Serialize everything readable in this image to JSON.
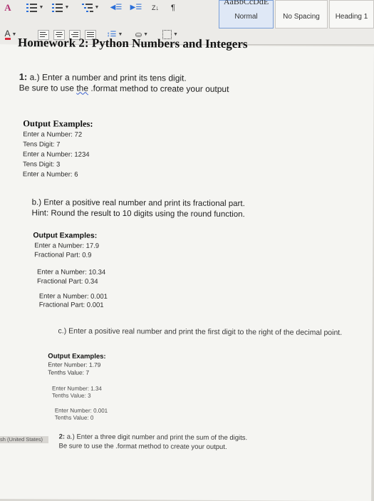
{
  "ribbon": {
    "style_heading_sample": "AaBbCcDdE",
    "styles": [
      "Normal",
      "No Spacing",
      "Heading 1"
    ],
    "sort_label": "Z↓"
  },
  "document": {
    "title": "Homework 2: Python Numbers and Integers",
    "q1": {
      "num": "1:",
      "line1": "a.) Enter a number and print its tens digit.",
      "line2_pre": "Be sure to use ",
      "line2_the": "the",
      "line2_post": " .format method to create your output"
    },
    "q1a_examples": {
      "heading": "Output Examples:",
      "lines": [
        "Enter a Number: 72",
        "Tens Digit: 7",
        "Enter a Number: 1234",
        "Tens Digit: 3",
        "Enter a Number: 6"
      ]
    },
    "q1b": {
      "line1": "b.) Enter a positive real number and print its fractional part.",
      "line2": "Hint: Round the result to 10 digits using the round function."
    },
    "q1b_examples": {
      "heading": "Output Examples:",
      "lines": [
        "Enter a Number: 17.9",
        "Fractional Part: 0.9",
        "Enter a Number: 10.34",
        "Fractional Part: 0.34",
        "Enter a Number: 0.001",
        "Fractional Part: 0.001"
      ]
    },
    "q1c": {
      "line1": "c.) Enter a positive real number and print the first digit to the right of the decimal point."
    },
    "q1c_examples": {
      "heading": "Output Examples:",
      "lines": [
        "Enter Number: 1.79",
        "Tenths Value: 7",
        "Enter Number: 1.34",
        "Tenths Value: 3",
        "Enter Number: 0.001",
        "Tenths Value: 0"
      ]
    },
    "q2": {
      "num": "2:",
      "line1": "a.) Enter a three digit number and print the sum of the digits.",
      "line2": "Be sure to use the .format method to create your output."
    }
  },
  "status_bar": {
    "language": "sh (United States)"
  }
}
